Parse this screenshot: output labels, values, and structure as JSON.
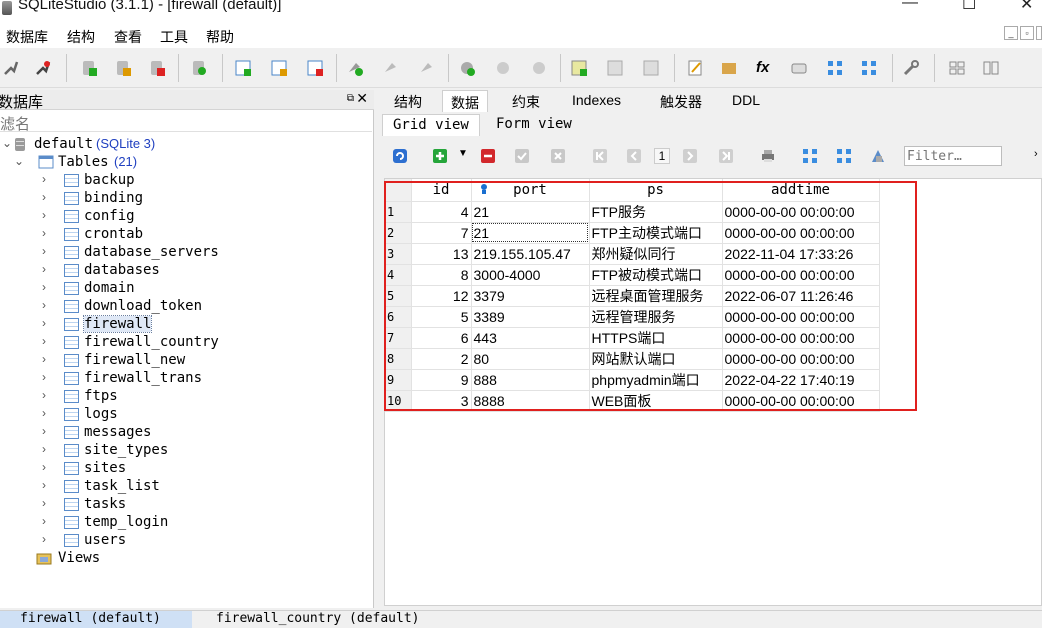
{
  "window": {
    "title": "SQLiteStudio (3.1.1) - [firewall (default)]",
    "min": "—",
    "max": "☐",
    "close": "✕"
  },
  "menu": [
    "数据库",
    "结构",
    "查看",
    "工具",
    "帮助"
  ],
  "db_panel": {
    "title": "数据库",
    "filter_placeholder": "滤名",
    "db_name": "default",
    "db_type": "(SQLite 3)",
    "tables_label": "Tables",
    "tables_count": "(21)",
    "tables": [
      "backup",
      "binding",
      "config",
      "crontab",
      "database_servers",
      "databases",
      "domain",
      "download_token",
      "firewall",
      "firewall_country",
      "firewall_new",
      "firewall_trans",
      "ftps",
      "logs",
      "messages",
      "site_types",
      "sites",
      "task_list",
      "tasks",
      "temp_login",
      "users"
    ],
    "selected_table": "firewall",
    "views_label": "Views"
  },
  "top_tabs": [
    "结构",
    "数据",
    "约束",
    "Indexes",
    "触发器",
    "DDL"
  ],
  "active_top_tab": "数据",
  "sub_tabs": [
    "Grid view",
    "Form view"
  ],
  "grid_toolbar": {
    "page": "1",
    "filter_placeholder": "Filter…"
  },
  "grid": {
    "columns": [
      "id",
      "port",
      "ps",
      "addtime"
    ],
    "rows": [
      {
        "n": "1",
        "id": "4",
        "port": "21",
        "ps": "FTP服务",
        "addtime": "0000-00-00 00:00:00"
      },
      {
        "n": "2",
        "id": "7",
        "port": "21",
        "ps": "FTP主动模式端口",
        "addtime": "0000-00-00 00:00:00"
      },
      {
        "n": "3",
        "id": "13",
        "port": "219.155.105.47",
        "ps": "郑州疑似同行",
        "addtime": "2022-11-04 17:33:26"
      },
      {
        "n": "4",
        "id": "8",
        "port": "3000-4000",
        "ps": "FTP被动模式端口",
        "addtime": "0000-00-00 00:00:00"
      },
      {
        "n": "5",
        "id": "12",
        "port": "3379",
        "ps": "远程桌面管理服务",
        "addtime": "2022-06-07 11:26:46"
      },
      {
        "n": "6",
        "id": "5",
        "port": "3389",
        "ps": "远程管理服务",
        "addtime": "0000-00-00 00:00:00"
      },
      {
        "n": "7",
        "id": "6",
        "port": "443",
        "ps": "HTTPS端口",
        "addtime": "0000-00-00 00:00:00"
      },
      {
        "n": "8",
        "id": "2",
        "port": "80",
        "ps": "网站默认端口",
        "addtime": "0000-00-00 00:00:00"
      },
      {
        "n": "9",
        "id": "9",
        "port": "888",
        "ps": "phpmyadmin端口",
        "addtime": "2022-04-22 17:40:19"
      },
      {
        "n": "10",
        "id": "3",
        "port": "8888",
        "ps": "WEB面板",
        "addtime": "0000-00-00 00:00:00"
      }
    ]
  },
  "bottom_tabs": [
    "firewall (default)",
    "firewall_country (default)"
  ],
  "colors": {
    "highlight": "#e0201e",
    "selection": "#dfe8f6"
  }
}
